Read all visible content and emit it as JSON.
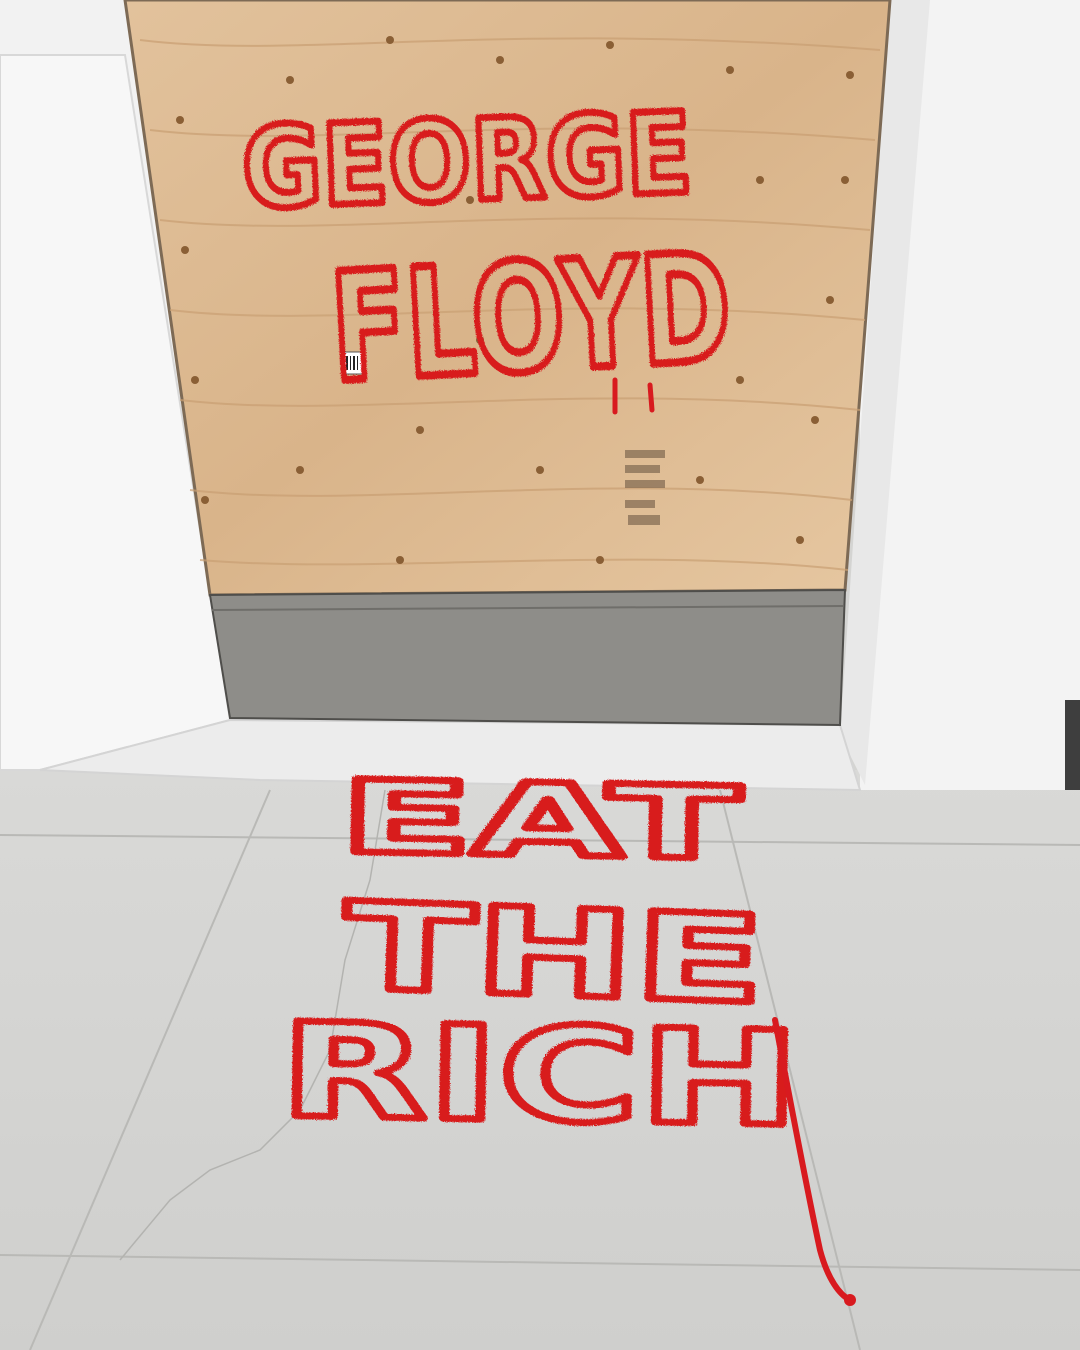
{
  "scene": {
    "description_free": true,
    "colors": {
      "wall": "#f3f3f3",
      "wall_shadow": "#e2e2e2",
      "plywood": "#dcb88f",
      "plywood_dark": "#c79a6a",
      "metal_panel": "#8d8c88",
      "sidewalk": "#d3d3d1",
      "paint": "#d81a1f"
    }
  },
  "board_graffiti": {
    "line1": "GEORGE",
    "line2": "FLOYD"
  },
  "sidewalk_graffiti": {
    "line1": "EAT",
    "line2": "THE",
    "line3": "RICH"
  },
  "sticker": {
    "label": ""
  }
}
